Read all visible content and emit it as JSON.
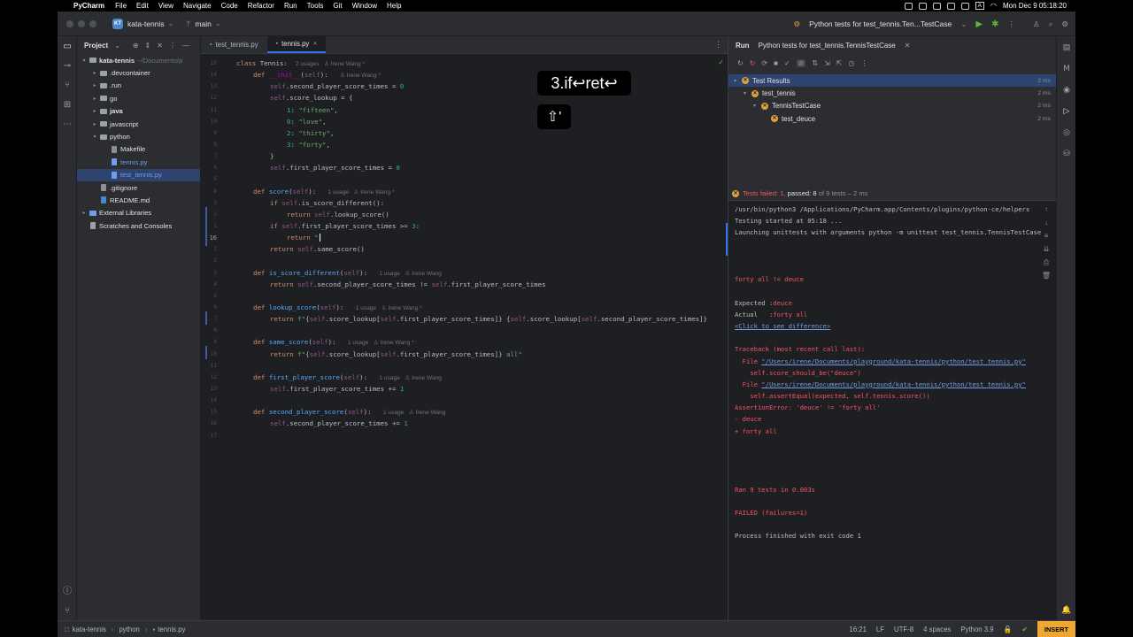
{
  "menubar": {
    "app": "PyCharm",
    "items": [
      "File",
      "Edit",
      "View",
      "Navigate",
      "Code",
      "Refactor",
      "Run",
      "Tools",
      "Git",
      "Window",
      "Help"
    ],
    "clock": "Mon Dec 9  05:18:20",
    "input_indicator": "A"
  },
  "titlebar": {
    "project_badge": "KT",
    "project": "kata-tennis",
    "branch": "main",
    "run_config": "Python tests for test_tennis.Ten...TestCase"
  },
  "project_panel": {
    "title": "Project",
    "tree": [
      {
        "label": "kata-tennis",
        "extra": "~/Documents/p",
        "depth": 0,
        "kind": "folder",
        "open": true,
        "bold": true
      },
      {
        "label": ".devcontainer",
        "depth": 1,
        "kind": "folder"
      },
      {
        "label": ".run",
        "depth": 1,
        "kind": "folder"
      },
      {
        "label": "go",
        "depth": 1,
        "kind": "folder"
      },
      {
        "label": "java",
        "depth": 1,
        "kind": "folder",
        "bold": true
      },
      {
        "label": "javascript",
        "depth": 1,
        "kind": "folder"
      },
      {
        "label": "python",
        "depth": 1,
        "kind": "folder",
        "open": true
      },
      {
        "label": "Makefile",
        "depth": 2,
        "kind": "file"
      },
      {
        "label": "tennis.py",
        "depth": 2,
        "kind": "py"
      },
      {
        "label": "test_tennis.py",
        "depth": 2,
        "kind": "py",
        "selected": true
      },
      {
        "label": ".gitignore",
        "depth": 1,
        "kind": "file"
      },
      {
        "label": "README.md",
        "depth": 1,
        "kind": "md"
      },
      {
        "label": "External Libraries",
        "depth": 0,
        "kind": "lib"
      },
      {
        "label": "Scratches and Consoles",
        "depth": 0,
        "kind": "scratch",
        "noarrow": true
      }
    ]
  },
  "editor": {
    "tabs": [
      {
        "label": "test_tennis.py",
        "active": false
      },
      {
        "label": "tennis.py",
        "active": true
      }
    ],
    "lines": [
      {
        "n": "15",
        "html": "<span class=\"kw\">class</span> Tennis:  <span class=\"hint\">2 usages   ♙ Irene Wang *</span>",
        "indent": 0
      },
      {
        "n": "14",
        "html": "<span class=\"kw\">def</span> <span class=\"dd\">__init__</span>(<span class=\"sf\">self</span>):   <span class=\"hint\">♙ Irene Wang *</span>",
        "indent": 1
      },
      {
        "n": "13",
        "html": "<span class=\"sf\">self</span>.second_player_score_times = <span class=\"nm\">0</span>",
        "indent": 2
      },
      {
        "n": "12",
        "html": "<span class=\"sf\">self</span>.score_lookup = {",
        "indent": 2
      },
      {
        "n": "11",
        "html": "<span class=\"nm\">1</span>: <span class=\"st\">\"fifteen\"</span>,",
        "indent": 3
      },
      {
        "n": "10",
        "html": "<span class=\"nm\">0</span>: <span class=\"st\">\"love\"</span>,",
        "indent": 3
      },
      {
        "n": "9",
        "html": "<span class=\"nm\">2</span>: <span class=\"st\">\"thirty\"</span>,",
        "indent": 3
      },
      {
        "n": "8",
        "html": "<span class=\"nm\">3</span>: <span class=\"st\">\"forty\"</span>,",
        "indent": 3
      },
      {
        "n": "7",
        "html": "}",
        "indent": 2
      },
      {
        "n": "6",
        "html": "<span class=\"sf\">self</span>.first_player_score_times = <span class=\"nm\">0</span>",
        "indent": 2
      },
      {
        "n": "5",
        "html": "",
        "indent": 0
      },
      {
        "n": "4",
        "html": "<span class=\"kw\">def</span> <span class=\"fn\">score</span>(<span class=\"sf\">self</span>):   <span class=\"hint\">1 usage   ♙ Irene Wang *</span>",
        "indent": 1
      },
      {
        "n": "3",
        "html": "<span class=\"kw\">if</span> <span class=\"sf\">self</span>.is_score_different():",
        "indent": 2
      },
      {
        "n": "2",
        "html": "<span class=\"kw\">return</span> <span class=\"sf\">self</span>.lookup_score()",
        "indent": 3
      },
      {
        "n": "1",
        "html": "<span class=\"kw\">if</span> <span class=\"sf\">self</span>.first_player_score_times >= <span class=\"nm\">3</span>:",
        "indent": 2
      },
      {
        "n": "16",
        "html": "<span class=\"kw\">return</span> <span class=\"st\">\"</span>",
        "indent": 3,
        "current": true
      },
      {
        "n": "1",
        "html": "<span class=\"kw\">return</span> <span class=\"sf\">self</span>.same_score()",
        "indent": 2
      },
      {
        "n": "2",
        "html": "",
        "indent": 0
      },
      {
        "n": "3",
        "html": "<span class=\"kw\">def</span> <span class=\"fn\">is_score_different</span>(<span class=\"sf\">self</span>):   <span class=\"hint\">1 usage   ♙ Irene Wang</span>",
        "indent": 1
      },
      {
        "n": "4",
        "html": "<span class=\"kw\">return</span> <span class=\"sf\">self</span>.second_player_score_times != <span class=\"sf\">self</span>.first_player_score_times",
        "indent": 2
      },
      {
        "n": "5",
        "html": "",
        "indent": 0
      },
      {
        "n": "6",
        "html": "<span class=\"kw\">def</span> <span class=\"fn\">lookup_score</span>(<span class=\"sf\">self</span>):   <span class=\"hint\">1 usage   ♙ Irene Wang *</span>",
        "indent": 1
      },
      {
        "n": "7",
        "html": "<span class=\"kw\">return</span> <span class=\"st\">f\"</span>{<span class=\"sf\">self</span>.score_lookup[<span class=\"sf\">self</span>.first_player_score_times]}<span class=\"st\"> </span>{<span class=\"sf\">self</span>.score_lookup[<span class=\"sf\">self</span>.second_player_score_times]}",
        "indent": 2
      },
      {
        "n": "8",
        "html": "",
        "indent": 0
      },
      {
        "n": "9",
        "html": "<span class=\"kw\">def</span> <span class=\"fn\">same_score</span>(<span class=\"sf\">self</span>):   <span class=\"hint\">1 usage   ♙ Irene Wang *</span>",
        "indent": 1
      },
      {
        "n": "10",
        "html": "<span class=\"kw\">return</span> <span class=\"st\">f\"</span>{<span class=\"sf\">self</span>.score_lookup[<span class=\"sf\">self</span>.first_player_score_times]}<span class=\"st\"> all\"</span>",
        "indent": 2
      },
      {
        "n": "11",
        "html": "",
        "indent": 0
      },
      {
        "n": "12",
        "html": "<span class=\"kw\">def</span> <span class=\"fn\">first_player_score</span>(<span class=\"sf\">self</span>):   <span class=\"hint\">1 usage   ♙ Irene Wang</span>",
        "indent": 1
      },
      {
        "n": "13",
        "html": "<span class=\"sf\">self</span>.first_player_score_times += <span class=\"nm\">1</span>",
        "indent": 2
      },
      {
        "n": "14",
        "html": "",
        "indent": 0
      },
      {
        "n": "15",
        "html": "<span class=\"kw\">def</span> <span class=\"fn\">second_player_score</span>(<span class=\"sf\">self</span>):   <span class=\"hint\">1 usage   ♙ Irene Wang</span>",
        "indent": 1
      },
      {
        "n": "16",
        "html": "<span class=\"sf\">self</span>.second_player_score_times += <span class=\"nm\">1</span>",
        "indent": 2
      },
      {
        "n": "17",
        "html": "",
        "indent": 0
      }
    ]
  },
  "key_overlay": {
    "keys": "3.if↩ret↩",
    "shift": "⇧'"
  },
  "run_panel": {
    "title": "Run",
    "config_tab": "Python tests for test_tennis.TennisTestCase",
    "tree": [
      {
        "label": "Test Results",
        "ms": "2 ms",
        "depth": 0,
        "selected": true
      },
      {
        "label": "test_tennis",
        "ms": "2 ms",
        "depth": 1
      },
      {
        "label": "TennisTestCase",
        "ms": "2 ms",
        "depth": 2
      },
      {
        "label": "test_deuce",
        "ms": "2 ms",
        "depth": 3
      }
    ],
    "summary": {
      "failed": "Tests failed: 1,",
      "passed": "passed: 8",
      "rest": "of 9 tests – 2 ms"
    },
    "console": [
      {
        "t": "/usr/bin/python3 /Applications/PyCharm.app/Contents/plugins/python-ce/helpers",
        "c": ""
      },
      {
        "t": "Testing started at 05:18 ...",
        "c": ""
      },
      {
        "t": "Launching unittests with arguments python -m unittest test_tennis.TennisTestCase",
        "c": ""
      },
      {
        "t": "",
        "c": ""
      },
      {
        "t": "",
        "c": ""
      },
      {
        "t": "",
        "c": ""
      },
      {
        "t": "forty all != deuce",
        "c": "err"
      },
      {
        "t": "",
        "c": ""
      },
      {
        "t": "Expected :",
        "c": "",
        "v": "deuce"
      },
      {
        "t": "Actual   :",
        "c": "",
        "v": "forty all"
      },
      {
        "t": "<Click to see difference>",
        "c": "link"
      },
      {
        "t": "",
        "c": ""
      },
      {
        "t": "Traceback (most recent call last):",
        "c": "err"
      },
      {
        "t": "  File ",
        "c": "err",
        "link": "\"/Users/irene/Documents/playground/kata-tennis/python/test_tennis.py\""
      },
      {
        "t": "    self.score_should_be(\"deuce\")",
        "c": "err"
      },
      {
        "t": "  File ",
        "c": "err",
        "link": "\"/Users/irene/Documents/playground/kata-tennis/python/test_tennis.py\""
      },
      {
        "t": "    self.assertEqual(expected, self.tennis.score())",
        "c": "err"
      },
      {
        "t": "AssertionError: 'deuce' != 'forty all'",
        "c": "err"
      },
      {
        "t": "- deuce",
        "c": "err"
      },
      {
        "t": "+ forty all",
        "c": "err"
      },
      {
        "t": "",
        "c": ""
      },
      {
        "t": "",
        "c": ""
      },
      {
        "t": "",
        "c": ""
      },
      {
        "t": "",
        "c": ""
      },
      {
        "t": "Ran 9 tests in 0.003s",
        "c": "err"
      },
      {
        "t": "",
        "c": ""
      },
      {
        "t": "FAILED (failures=1)",
        "c": "err"
      },
      {
        "t": "",
        "c": ""
      },
      {
        "t": "Process finished with exit code 1",
        "c": ""
      }
    ]
  },
  "statusbar": {
    "breadcrumb": [
      "kata-tennis",
      "python",
      "tennis.py"
    ],
    "position": "16:21",
    "line_sep": "LF",
    "encoding": "UTF-8",
    "indent": "4 spaces",
    "interpreter": "Python 3.9",
    "mode": "INSERT"
  },
  "colors": {
    "accent": "#3574f0",
    "insert": "#f0a732",
    "error": "#f75464",
    "success": "#5fb832"
  }
}
